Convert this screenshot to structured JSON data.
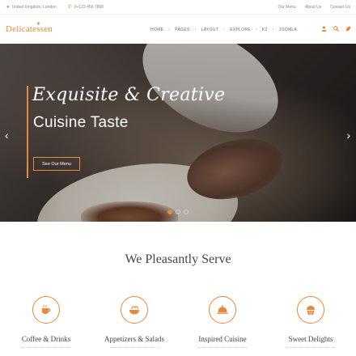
{
  "topbar": {
    "location": "United Kingdom, London",
    "phone": "0+123 456 7890",
    "links": [
      "Our Menu",
      "About Us",
      "Contact Us"
    ]
  },
  "header": {
    "logo": "Delicatessen",
    "nav": [
      "HOME",
      "PAGES",
      "LAYOUT",
      "EXPLORE",
      "K2",
      "JOOMLA"
    ],
    "icons": [
      "user-icon",
      "search-icon",
      "leaf-icon"
    ]
  },
  "hero": {
    "script_text": "Exquisite & Creative",
    "title": "Cuisine Taste",
    "button_label": "See Our Menu",
    "prev_arrow": "‹",
    "next_arrow": "›",
    "slide_count": 3,
    "active_slide": 1
  },
  "serve": {
    "title": "We Pleasantly Serve",
    "items": [
      {
        "name": "Coffee & Drinks",
        "icon": "coffee-cup-icon"
      },
      {
        "name": "Appetizers & Salads",
        "icon": "salad-bowl-icon"
      },
      {
        "name": "Inspired Cuisine",
        "icon": "cloche-icon"
      },
      {
        "name": "Sweet Delights",
        "icon": "cupcake-icon"
      }
    ]
  },
  "colors": {
    "accent": "#e8883a",
    "leaf": "#7cb342"
  }
}
